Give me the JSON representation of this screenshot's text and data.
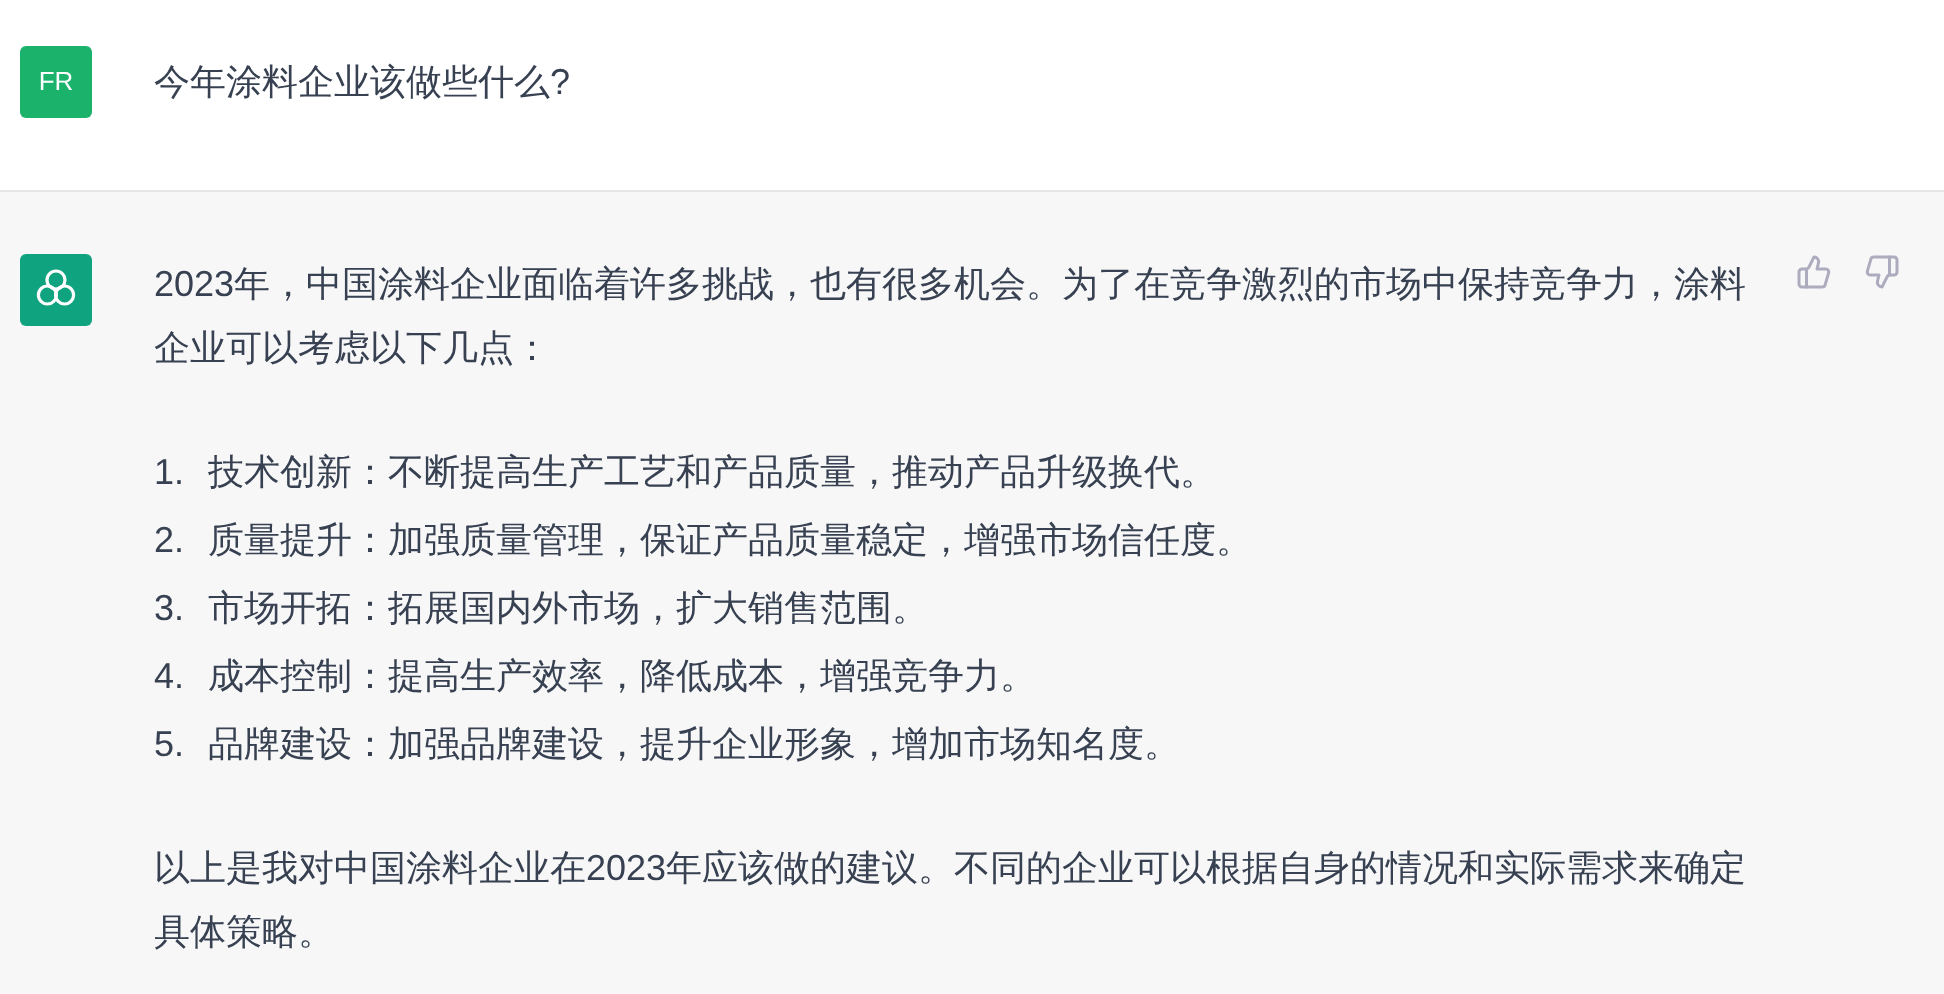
{
  "user_message": {
    "avatar": "FR",
    "text": "今年涂料企业该做些什么?"
  },
  "reply": {
    "intro": "2023年，中国涂料企业面临着许多挑战，也有很多机会。为了在竞争激烈的市场中保持竞争力，涂料企业可以考虑以下几点：",
    "items": [
      {
        "number": "1.",
        "text": "技术创新：不断提高生产工艺和产品质量，推动产品升级换代。"
      },
      {
        "number": "2.",
        "text": "质量提升：加强质量管理，保证产品质量稳定，增强市场信任度。"
      },
      {
        "number": "3.",
        "text": "市场开拓：拓展国内外市场，扩大销售范围。"
      },
      {
        "number": "4.",
        "text": "成本控制：提高生产效率，降低成本，增强竞争力。"
      },
      {
        "number": "5.",
        "text": "品牌建设：加强品牌建设，提升企业形象，增加市场知名度。"
      }
    ],
    "closing": "以上是我对中国涂料企业在2023年应该做的建议。不同的企业可以根据自身的情况和实际需求来确定具体策略。"
  }
}
